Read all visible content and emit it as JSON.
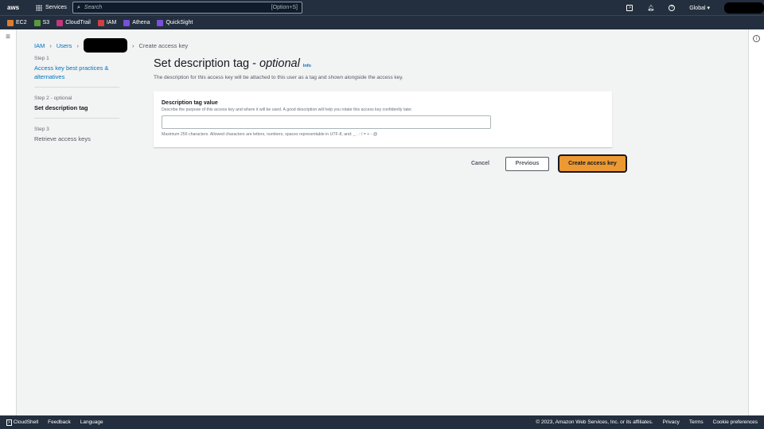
{
  "nav": {
    "logo": "aws",
    "services": "Services",
    "search_placeholder": "Search",
    "search_shortcut": "[Option+S]",
    "region": "Global"
  },
  "favorites": [
    {
      "label": "EC2",
      "color": "#e07b2f"
    },
    {
      "label": "S3",
      "color": "#5a9a3a"
    },
    {
      "label": "CloudTrail",
      "color": "#c7357a"
    },
    {
      "label": "IAM",
      "color": "#d13f3f"
    },
    {
      "label": "Athena",
      "color": "#7a4fdc"
    },
    {
      "label": "QuickSight",
      "color": "#7a4fdc"
    }
  ],
  "breadcrumb": {
    "iam": "IAM",
    "users": "Users",
    "current": "Create access key"
  },
  "steps": [
    {
      "num": "Step 1",
      "label": "Access key best practices & alternatives"
    },
    {
      "num": "Step 2 - optional",
      "label": "Set description tag"
    },
    {
      "num": "Step 3",
      "label": "Retrieve access keys"
    }
  ],
  "page": {
    "title": "Set description tag - ",
    "title_optional": "optional",
    "info": "Info",
    "subtitle": "The description for this access key will be attached to this user as a tag and shown alongside the access key."
  },
  "form": {
    "label": "Description tag value",
    "description": "Describe the purpose of this access key and where it will be used. A good description will help you rotate this access key confidently later.",
    "value": "",
    "constraint": "Maximum 256 characters. Allowed characters are letters, numbers, spaces representable in UTF-8, and: _ . : / = + - @"
  },
  "buttons": {
    "cancel": "Cancel",
    "previous": "Previous",
    "create": "Create access key"
  },
  "footer": {
    "cloudshell": "CloudShell",
    "feedback": "Feedback",
    "language": "Language",
    "copyright": "© 2023, Amazon Web Services, Inc. or its affiliates.",
    "privacy": "Privacy",
    "terms": "Terms",
    "cookies": "Cookie preferences"
  }
}
